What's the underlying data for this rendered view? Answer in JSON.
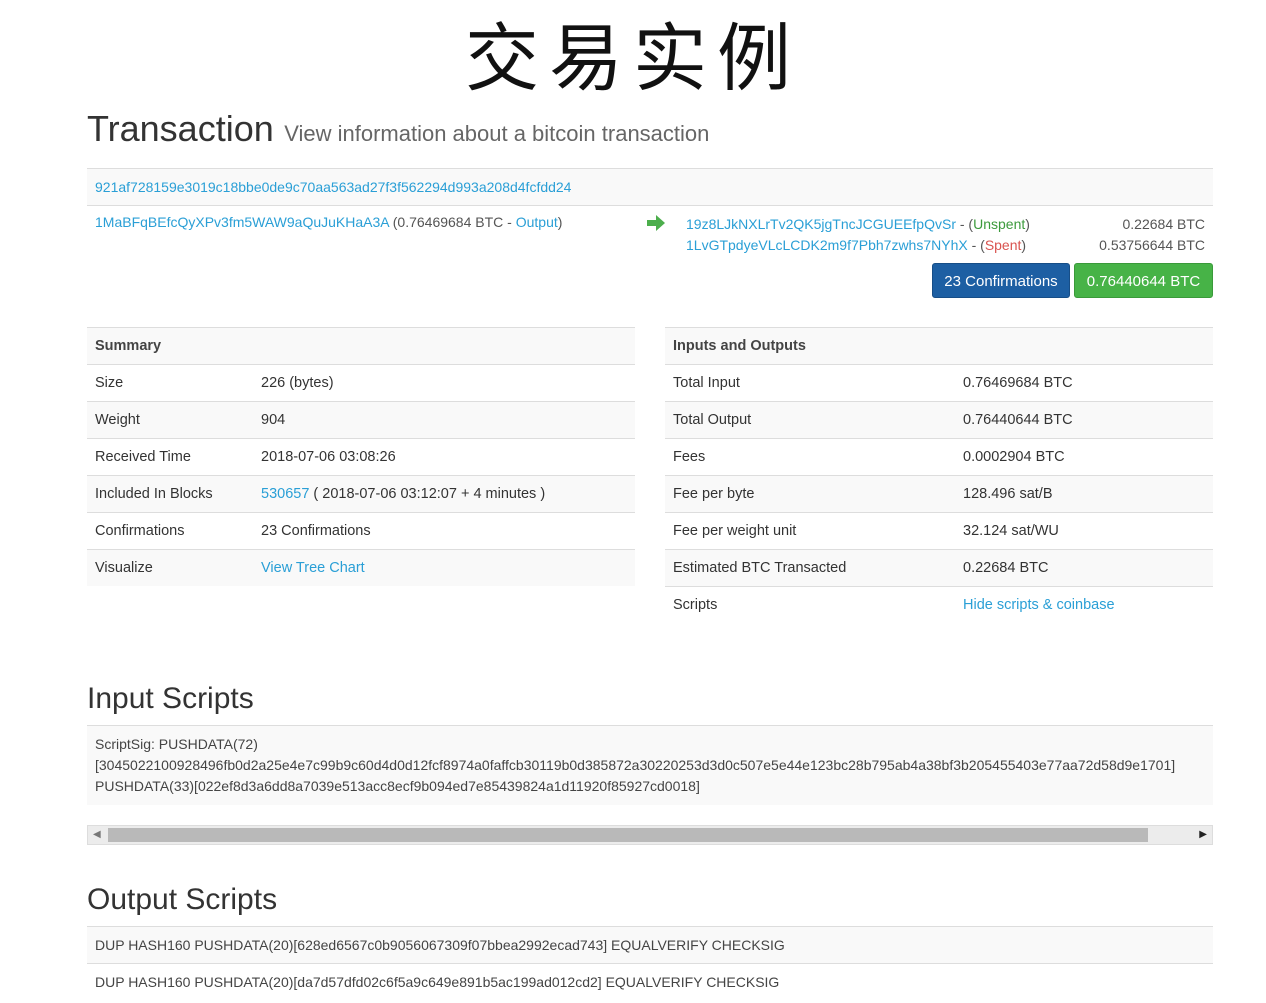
{
  "banner": "交易实例",
  "header": {
    "title": "Transaction",
    "subtitle": "View information about a bitcoin transaction"
  },
  "tx_hash": "921af728159e3019c18bbe0de9c70aa563ad27f3f562294d993a208d4fcfdd24",
  "input": {
    "address": "1MaBFqBEfcQyXPv3fm5WAW9aQuJuKHaA3A",
    "amount_text": " (0.76469684 BTC - ",
    "link": "Output",
    "close": ")"
  },
  "outputs": [
    {
      "address": "19z8LJkNXLrTv2QK5jgTncJCGUEEfpQvSr",
      "sep": " - (",
      "status": "Unspent",
      "close": ")",
      "amount": "0.22684 BTC"
    },
    {
      "address": "1LvGTpdyeVLcLCDK2m9f7Pbh7zwhs7NYhX",
      "sep": " - (",
      "status": "Spent",
      "close": ")",
      "amount": "0.53756644 BTC"
    }
  ],
  "buttons": {
    "confirmations": "23 Confirmations",
    "total": "0.76440644 BTC"
  },
  "summary": {
    "title": "Summary",
    "size_label": "Size",
    "size_value": "226 (bytes)",
    "weight_label": "Weight",
    "weight_value": "904",
    "received_label": "Received Time",
    "received_value": "2018-07-06 03:08:26",
    "included_label": "Included In Blocks",
    "included_block": "530657",
    "included_rest": " ( 2018-07-06 03:12:07 + 4 minutes )",
    "confirmations_label": "Confirmations",
    "confirmations_value": "23 Confirmations",
    "visualize_label": "Visualize",
    "visualize_link": "View Tree Chart"
  },
  "io": {
    "title": "Inputs and Outputs",
    "total_input_label": "Total Input",
    "total_input_value": "0.76469684 BTC",
    "total_output_label": "Total Output",
    "total_output_value": "0.76440644 BTC",
    "fees_label": "Fees",
    "fees_value": "0.0002904 BTC",
    "fee_byte_label": "Fee per byte",
    "fee_byte_value": "128.496 sat/B",
    "fee_wu_label": "Fee per weight unit",
    "fee_wu_value": "32.124 sat/WU",
    "est_label": "Estimated BTC Transacted",
    "est_value": "0.22684 BTC",
    "scripts_label": "Scripts",
    "scripts_link": "Hide scripts & coinbase"
  },
  "input_scripts": {
    "title": "Input Scripts",
    "line1": "ScriptSig: PUSHDATA(72)",
    "line2": "[3045022100928496fb0d2a25e4e7c99b9c60d4d0d12fcf8974a0faffcb30119b0d385872a30220253d3d0c507e5e44e123bc28b795ab4a38bf3b205455403e77aa72d58d9e1701]",
    "line3": "PUSHDATA(33)[022ef8d3a6dd8a7039e513acc8ecf9b094ed7e85439824a1d11920f85927cd0018]"
  },
  "output_scripts": {
    "title": "Output Scripts",
    "items": [
      "DUP HASH160 PUSHDATA(20)[628ed6567c0b9056067309f07bbea2992ecad743] EQUALVERIFY CHECKSIG",
      "DUP HASH160 PUSHDATA(20)[da7d57dfd02c6f5a9c649e891b5ac199ad012cd2] EQUALVERIFY CHECKSIG"
    ]
  },
  "colors": {
    "link": "#2a9fd6",
    "confirm_button": "#1d5fa3",
    "total_button": "#47b347",
    "unspent": "#3c9a3c",
    "spent": "#d9534f"
  }
}
